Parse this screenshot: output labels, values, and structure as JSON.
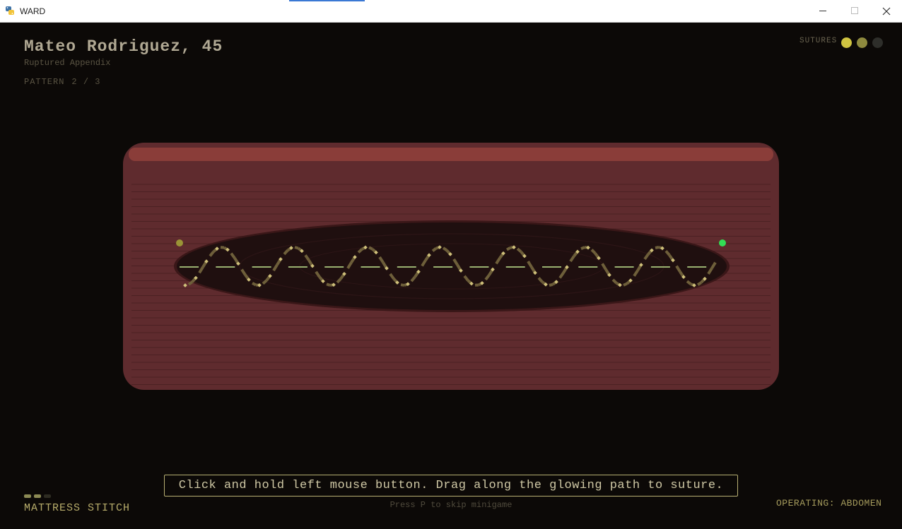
{
  "window": {
    "title": "WARD",
    "app_icon": "python-icon"
  },
  "patient": {
    "name": "Mateo Rodriguez, 45",
    "diagnosis": "Ruptured Appendix"
  },
  "pattern": {
    "label": "PATTERN",
    "value": "2 / 3"
  },
  "sutures": {
    "label": "SUTURES",
    "states": [
      "#d0c441",
      "#8e8a3e",
      "#2e2e2a"
    ]
  },
  "stitch": {
    "name": "MATTRESS STITCH",
    "progress_pips": [
      "#8c8a54",
      "#8c8a54",
      "#2e2c22"
    ]
  },
  "instruction": "Click and hold left mouse button. Drag along the glowing path to suture.",
  "skip_hint": "Press P to skip minigame",
  "operating": "OPERATING: ABDOMEN",
  "colors": {
    "background": "#0c0907",
    "tissue": "#5f2b2e",
    "tissue_highlight": "#8a3d39",
    "wound": "#1f0f0f",
    "path_glow": "#a8c27b",
    "stitch_marker": "#cfc07a",
    "start_point": "#9a9436",
    "end_point": "#33dd55"
  }
}
